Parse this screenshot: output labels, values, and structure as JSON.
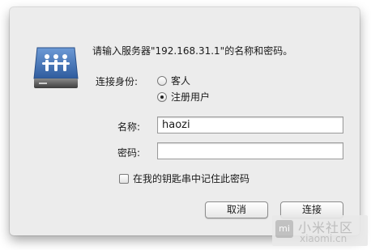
{
  "dialog": {
    "prompt": "请输入服务器\"192.168.31.1\"的名称和密码。",
    "connect_as_label": "连接身份:",
    "options": {
      "guest": "客人",
      "registered": "注册用户"
    },
    "selected_option": "registered",
    "name_label": "名称:",
    "name_value": "haozi",
    "password_label": "密码:",
    "password_value": "",
    "keychain_label": "在我的钥匙串中记住此密码",
    "keychain_checked": false,
    "cancel_label": "取消",
    "connect_label": "连接"
  },
  "watermark": {
    "logo_glyph": "mi",
    "title": "小米社区",
    "subtitle": "xiaomi.cn"
  },
  "colors": {
    "dialog_bg": "#ececec",
    "icon_blue": "#3e6dae"
  }
}
